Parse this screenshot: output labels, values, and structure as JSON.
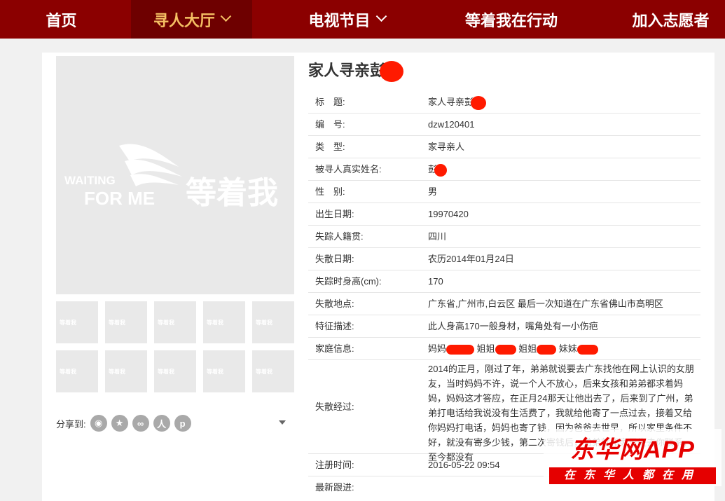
{
  "nav": {
    "items": [
      {
        "label": "首页"
      },
      {
        "label": "寻人大厅"
      },
      {
        "label": "电视节目"
      },
      {
        "label": "等着我在行动"
      },
      {
        "label": "加入志愿者"
      }
    ]
  },
  "colors": {
    "nav_bg": "#8b0000",
    "nav_active_bg": "#6e0000",
    "nav_active_text": "#f5c064",
    "redaction": "#ff1a00"
  },
  "photo": {
    "logo_en_1": "WAITING",
    "logo_en_2": "FOR ME",
    "logo_cn": "等着我",
    "thumb_text": "等着我"
  },
  "share": {
    "label": "分享到:"
  },
  "page_title": "家人寻亲彭",
  "info": {
    "title_label": "标　题:",
    "title_value": "家人寻亲彭",
    "id_label": "编　号:",
    "id_value": "dzw120401",
    "type_label": "类　型:",
    "type_value": "家寻亲人",
    "name_label": "被寻人真实姓名:",
    "name_value": "彭",
    "gender_label": "性　别:",
    "gender_value": "男",
    "birth_label": "出生日期:",
    "birth_value": "19970420",
    "origin_label": "失踪人籍贯:",
    "origin_value": "四川",
    "lost_date_label": "失散日期:",
    "lost_date_value": "农历2014年01月24日",
    "height_label": "失踪时身高(cm):",
    "height_value": "170",
    "place_label": "失散地点:",
    "place_value": "广东省,广州市,白云区 最后一次知道在广东省佛山市高明区",
    "feature_label": "特征描述:",
    "feature_value": "此人身高170一般身材，嘴角处有一小伤疤",
    "family_label": "家庭信息:",
    "family_mom": "妈妈",
    "family_sis1": "姐姐",
    "family_sis2": "姐姐",
    "family_sis3": "妹妹",
    "story_label": "失散经过:",
    "story_value": "2014的正月，刚过了年，弟弟就说要去广东找他在网上认识的女朋友，当时妈妈不许，说一个人不放心，后来女孩和弟弟都求着妈妈，妈妈这才答应，在正月24那天让他出去了，后来到了广州，弟弟打电话给我说没有生活费了，我就给他寄了一点过去，接着又给你妈妈打电话，妈妈也寄了钱，因为爸爸去世早，所以家里条件不好，就没有寄多少钱，第二次寄钱后，弟弟就和家里失去你联系，至今都没有",
    "reg_label": "注册时间:",
    "reg_value": "2016-05-22 09:54",
    "follow_label": "最新跟进:"
  },
  "watermark": {
    "top": "东华网APP",
    "bottom": "在东华人都在用"
  }
}
